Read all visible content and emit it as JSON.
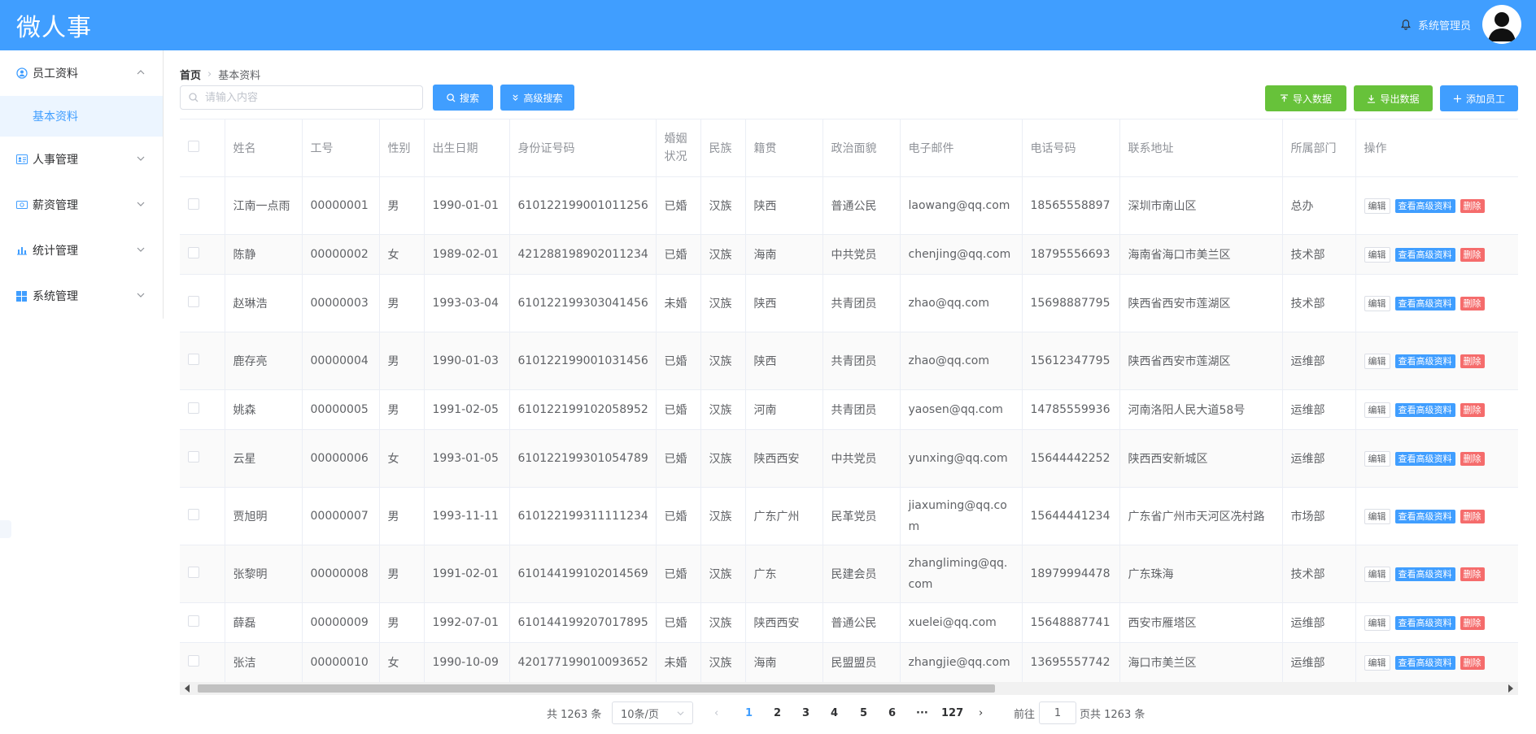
{
  "app": {
    "title": "微人事",
    "username": "系统管理员"
  },
  "sidebar": {
    "items": [
      {
        "label": "员工资料",
        "icon": "user-circle-icon",
        "expanded": true,
        "children": [
          {
            "label": "基本资料",
            "active": true
          }
        ]
      },
      {
        "label": "人事管理",
        "icon": "id-card-icon",
        "expanded": false
      },
      {
        "label": "薪资管理",
        "icon": "money-icon",
        "expanded": false
      },
      {
        "label": "统计管理",
        "icon": "bar-chart-icon",
        "expanded": false
      },
      {
        "label": "系统管理",
        "icon": "windows-icon",
        "expanded": false
      }
    ]
  },
  "breadcrumb": {
    "home": "首页",
    "current": "基本资料"
  },
  "toolbar": {
    "search_placeholder": "请输入内容",
    "search_label": "搜索",
    "advanced_search_label": "高级搜索",
    "import_label": "导入数据",
    "export_label": "导出数据",
    "add_label": "添加员工"
  },
  "table": {
    "columns": [
      "姓名",
      "工号",
      "性别",
      "出生日期",
      "身份证号码",
      "婚姻状况",
      "民族",
      "籍贯",
      "政治面貌",
      "电子邮件",
      "电话号码",
      "联系地址",
      "所属部门",
      "操作"
    ],
    "actions": {
      "edit": "编辑",
      "view": "查看高级资料",
      "delete": "删除"
    },
    "rows": [
      {
        "name": "江南一点雨",
        "id": "00000001",
        "gender": "男",
        "birth": "1990-01-01",
        "idcard": "610122199001011256",
        "marital": "已婚",
        "nation": "汉族",
        "native": "陕西",
        "politic": "普通公民",
        "email": "laowang@qq.com",
        "phone": "18565558897",
        "address": "深圳市南山区",
        "dept": "总办"
      },
      {
        "name": "陈静",
        "id": "00000002",
        "gender": "女",
        "birth": "1989-02-01",
        "idcard": "421288198902011234",
        "marital": "已婚",
        "nation": "汉族",
        "native": "海南",
        "politic": "中共党员",
        "email": "chenjing@qq.com",
        "phone": "18795556693",
        "address": "海南省海口市美兰区",
        "dept": "技术部"
      },
      {
        "name": "赵琳浩",
        "id": "00000003",
        "gender": "男",
        "birth": "1993-03-04",
        "idcard": "610122199303041456",
        "marital": "未婚",
        "nation": "汉族",
        "native": "陕西",
        "politic": "共青团员",
        "email": "zhao@qq.com",
        "phone": "15698887795",
        "address": "陕西省西安市莲湖区",
        "dept": "技术部"
      },
      {
        "name": "鹿存亮",
        "id": "00000004",
        "gender": "男",
        "birth": "1990-01-03",
        "idcard": "610122199001031456",
        "marital": "已婚",
        "nation": "汉族",
        "native": "陕西",
        "politic": "共青团员",
        "email": "zhao@qq.com",
        "phone": "15612347795",
        "address": "陕西省西安市莲湖区",
        "dept": "运维部"
      },
      {
        "name": "姚森",
        "id": "00000005",
        "gender": "男",
        "birth": "1991-02-05",
        "idcard": "610122199102058952",
        "marital": "已婚",
        "nation": "汉族",
        "native": "河南",
        "politic": "共青团员",
        "email": "yaosen@qq.com",
        "phone": "14785559936",
        "address": "河南洛阳人民大道58号",
        "dept": "运维部"
      },
      {
        "name": "云星",
        "id": "00000006",
        "gender": "女",
        "birth": "1993-01-05",
        "idcard": "610122199301054789",
        "marital": "已婚",
        "nation": "汉族",
        "native": "陕西西安",
        "politic": "中共党员",
        "email": "yunxing@qq.com",
        "phone": "15644442252",
        "address": "陕西西安新城区",
        "dept": "运维部"
      },
      {
        "name": "贾旭明",
        "id": "00000007",
        "gender": "男",
        "birth": "1993-11-11",
        "idcard": "610122199311111234",
        "marital": "已婚",
        "nation": "汉族",
        "native": "广东广州",
        "politic": "民革党员",
        "email": "jiaxuming@qq.com",
        "phone": "15644441234",
        "address": "广东省广州市天河区冼村路",
        "dept": "市场部"
      },
      {
        "name": "张黎明",
        "id": "00000008",
        "gender": "男",
        "birth": "1991-02-01",
        "idcard": "610144199102014569",
        "marital": "已婚",
        "nation": "汉族",
        "native": "广东",
        "politic": "民建会员",
        "email": "zhangliming@qq.com",
        "phone": "18979994478",
        "address": "广东珠海",
        "dept": "技术部"
      },
      {
        "name": "薛磊",
        "id": "00000009",
        "gender": "男",
        "birth": "1992-07-01",
        "idcard": "610144199207017895",
        "marital": "已婚",
        "nation": "汉族",
        "native": "陕西西安",
        "politic": "普通公民",
        "email": "xuelei@qq.com",
        "phone": "15648887741",
        "address": "西安市雁塔区",
        "dept": "运维部"
      },
      {
        "name": "张洁",
        "id": "00000010",
        "gender": "女",
        "birth": "1990-10-09",
        "idcard": "420177199010093652",
        "marital": "未婚",
        "nation": "汉族",
        "native": "海南",
        "politic": "民盟盟员",
        "email": "zhangjie@qq.com",
        "phone": "13695557742",
        "address": "海口市美兰区",
        "dept": "运维部"
      }
    ]
  },
  "pagination": {
    "total_text": "共 1263 条",
    "page_size": "10条/页",
    "pages": [
      "1",
      "2",
      "3",
      "4",
      "5",
      "6",
      "···",
      "127"
    ],
    "current": "1",
    "goto_label": "前往",
    "goto_value": "1",
    "suffix": "页共 1263 条"
  },
  "colors": {
    "primary": "#409eff",
    "success": "#67c23a",
    "danger": "#f56c6c"
  }
}
